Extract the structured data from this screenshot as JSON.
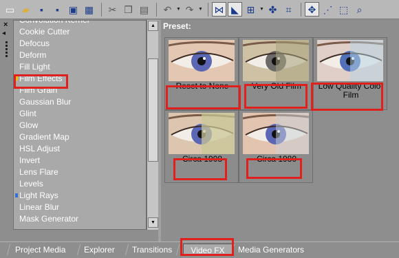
{
  "toolbar": {
    "buttons": [
      {
        "name": "new-icon",
        "glyph": "▭",
        "color": "#ffffff"
      },
      {
        "name": "open-folder-icon",
        "glyph": "▰",
        "color": "#d9b040"
      },
      {
        "name": "save-icon",
        "glyph": "▪",
        "color": "#1c3d8a"
      },
      {
        "name": "save-as-icon",
        "glyph": "▪",
        "color": "#1c3d8a"
      },
      {
        "name": "render-icon",
        "glyph": "▣",
        "color": "#1c3d8a"
      },
      {
        "name": "properties-icon",
        "glyph": "▦",
        "color": "#1c3d8a"
      },
      {
        "name": "cut-icon",
        "glyph": "✂",
        "color": "#555555"
      },
      {
        "name": "copy-icon",
        "glyph": "❐",
        "color": "#555555"
      },
      {
        "name": "paste-icon",
        "glyph": "▤",
        "color": "#555555"
      },
      {
        "name": "undo-icon",
        "glyph": "↶",
        "color": "#5a5a5a"
      },
      {
        "name": "redo-icon",
        "glyph": "↷",
        "color": "#5a5a5a"
      },
      {
        "name": "snapping-icon",
        "glyph": "⋈",
        "color": "#1a3a8a"
      },
      {
        "name": "auto-crossfade-icon",
        "glyph": "◣",
        "color": "#1a3a8a"
      },
      {
        "name": "ripple-edit-icon",
        "glyph": "⊞",
        "color": "#1a3a8a"
      },
      {
        "name": "lock-envelopes-icon",
        "glyph": "✤",
        "color": "#1a3a8a"
      },
      {
        "name": "ignore-grouping-icon",
        "glyph": "⌗",
        "color": "#1a3a8a"
      },
      {
        "name": "normal-edit-tool-icon",
        "glyph": "✥",
        "color": "#1a3a8a"
      },
      {
        "name": "envelope-tool-icon",
        "glyph": "⋰",
        "color": "#1a3a8a"
      },
      {
        "name": "selection-tool-icon",
        "glyph": "⬚",
        "color": "#1a3a8a"
      },
      {
        "name": "zoom-tool-icon",
        "glyph": "⌕",
        "color": "#1a3a8a"
      }
    ]
  },
  "sidebar": {
    "close_glyph": "×",
    "pin_glyph": "◂"
  },
  "effects_list": {
    "items": [
      {
        "label": "Convolution Kernel",
        "marker": ""
      },
      {
        "label": "Cookie Cutter",
        "marker": ""
      },
      {
        "label": "Defocus",
        "marker": ""
      },
      {
        "label": "Deform",
        "marker": ""
      },
      {
        "label": "Fill Light",
        "marker": ""
      },
      {
        "label": "Film Effects",
        "marker": "#f2c200"
      },
      {
        "label": "Film Grain",
        "marker": ""
      },
      {
        "label": "Gaussian Blur",
        "marker": ""
      },
      {
        "label": "Glint",
        "marker": ""
      },
      {
        "label": "Glow",
        "marker": ""
      },
      {
        "label": "Gradient Map",
        "marker": ""
      },
      {
        "label": "HSL Adjust",
        "marker": ""
      },
      {
        "label": "Invert",
        "marker": ""
      },
      {
        "label": "Lens Flare",
        "marker": ""
      },
      {
        "label": "Levels",
        "marker": ""
      },
      {
        "label": "Light Rays",
        "marker": "#3a6fd0"
      },
      {
        "label": "Linear Blur",
        "marker": ""
      },
      {
        "label": "Mask Generator",
        "marker": ""
      }
    ],
    "scroll_up_glyph": "▲",
    "scroll_down_glyph": "▼"
  },
  "presets": {
    "heading": "Preset:",
    "items": [
      {
        "label": "Reset to None",
        "style": "normal"
      },
      {
        "label": "Very Old Film",
        "style": "old"
      },
      {
        "label": "Low Quality Color Film",
        "style": "lowq"
      },
      {
        "label": "Circa 1908",
        "style": "c1908"
      },
      {
        "label": "Circa 1980",
        "style": "c1980"
      }
    ]
  },
  "tabs": [
    {
      "label": "Project Media",
      "active": false
    },
    {
      "label": "Explorer",
      "active": false
    },
    {
      "label": "Transitions",
      "active": false
    },
    {
      "label": "Video FX",
      "active": true
    },
    {
      "label": "Media Generators",
      "active": false
    }
  ],
  "highlight_color": "#e0201c"
}
